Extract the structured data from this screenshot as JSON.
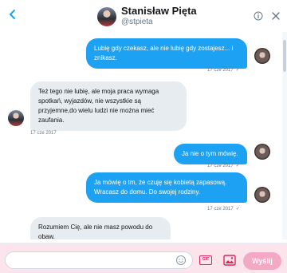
{
  "header": {
    "name": "Stanisław Pięta",
    "handle": "@stpieta"
  },
  "messages": [
    {
      "direction": "out",
      "text": "Lubię gdy czekasz, ale nie lubię gdy zostajesz... i znikasz.",
      "date": "17 cze 2017",
      "status": "✓"
    },
    {
      "direction": "in",
      "text": "Też tego nie lubię, ale moja praca wymaga spotkań, wyjazdów, nie wszystkie są przyjemne,do wielu ludzi nie można mieć zaufania.",
      "date": "17 cze 2017"
    },
    {
      "direction": "out",
      "text": "Ja nie o tym mówię.",
      "date": "17 cze 2017",
      "status": "✓"
    },
    {
      "direction": "out",
      "text": "Ja mówię o tm, że czuję się kobietą zapasową. Wracasz do domu. Do swojej rodziny.",
      "date": "17 cze 2017",
      "status": "✓"
    },
    {
      "direction": "in",
      "text": "Rozumiem Cię, ale nie masz powodu do obaw."
    }
  ],
  "composer": {
    "placeholder": "",
    "gif_label": "GIF",
    "send_label": "Wyślij"
  },
  "colors": {
    "accent": "#1da1f2",
    "composer_bg": "#fce4ec",
    "send_button": "#f3a9c4",
    "gif": "#e0245e"
  },
  "icons": [
    "back-arrow-icon",
    "info-icon",
    "close-icon",
    "emoji-icon",
    "gif-icon",
    "image-icon"
  ]
}
